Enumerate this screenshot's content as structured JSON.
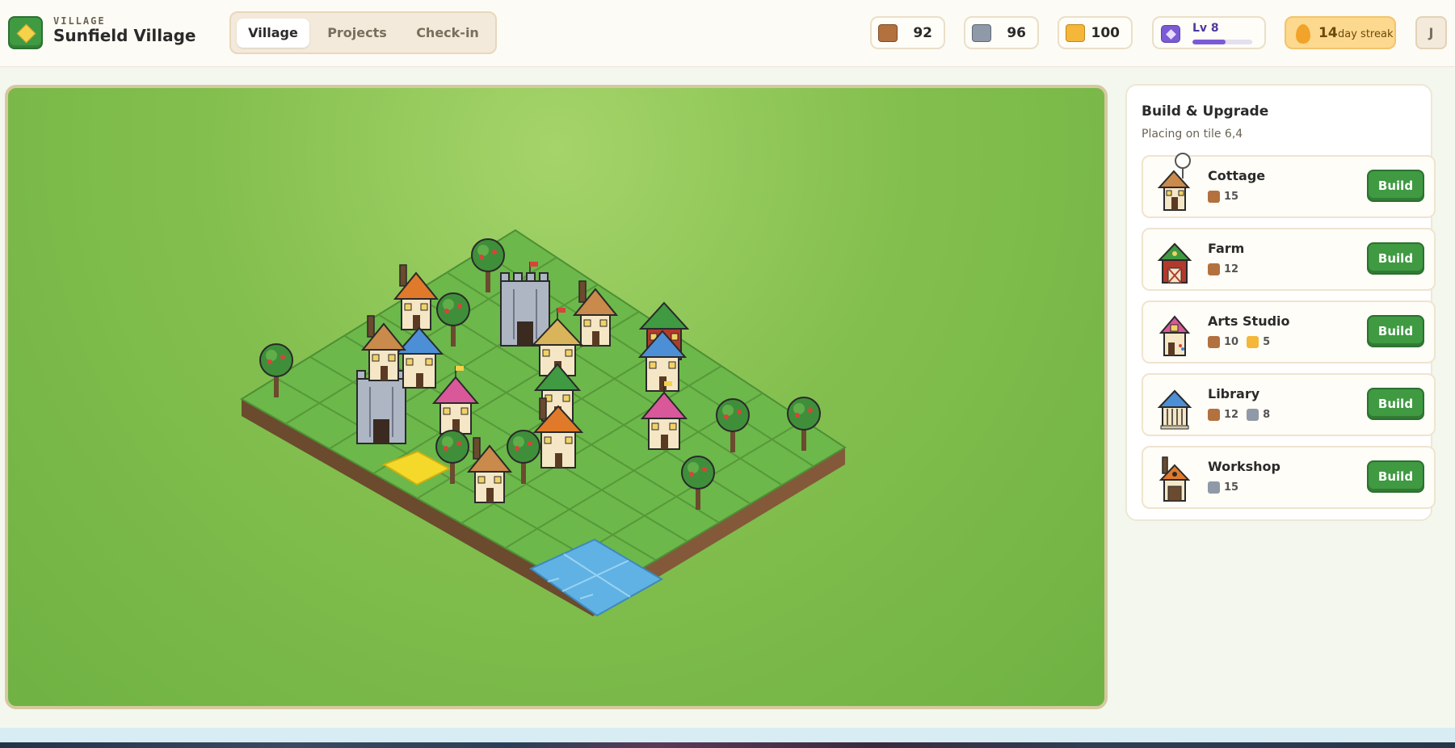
{
  "header": {
    "brand_sub": "VILLAGE",
    "brand_title": "Sunfield Village",
    "tabs": [
      {
        "label": "Village",
        "active": true
      },
      {
        "label": "Projects",
        "active": false
      },
      {
        "label": "Check-in",
        "active": false
      }
    ],
    "resources": [
      {
        "name": "wood",
        "icon": "wood-icon",
        "color": "#b3713f",
        "value": "92"
      },
      {
        "name": "stone",
        "icon": "stone-icon",
        "color": "#8f99a8",
        "value": "96"
      },
      {
        "name": "gold",
        "icon": "gold-icon",
        "color": "#f4b73a",
        "value": "100"
      }
    ],
    "level": {
      "label": "Lv 8",
      "progress": 0.55
    },
    "streak": {
      "number": "14",
      "label": "day streak"
    },
    "avatar_initial": "J"
  },
  "panel": {
    "title": "Build & Upgrade",
    "subtitle": "Placing on tile 6,4",
    "build_label": "Build",
    "items": [
      {
        "name": "Cottage",
        "costs": [
          {
            "res": "wood",
            "color": "#b3713f",
            "amount": "15"
          }
        ]
      },
      {
        "name": "Farm",
        "costs": [
          {
            "res": "wood",
            "color": "#b3713f",
            "amount": "12"
          }
        ]
      },
      {
        "name": "Arts Studio",
        "costs": [
          {
            "res": "wood",
            "color": "#b3713f",
            "amount": "10"
          },
          {
            "res": "gold",
            "color": "#f4b73a",
            "amount": "5"
          }
        ]
      },
      {
        "name": "Library",
        "costs": [
          {
            "res": "wood",
            "color": "#b3713f",
            "amount": "12"
          },
          {
            "res": "stone",
            "color": "#8f99a8",
            "amount": "8"
          }
        ]
      },
      {
        "name": "Workshop",
        "costs": [
          {
            "res": "stone",
            "color": "#8f99a8",
            "amount": "15"
          }
        ]
      }
    ]
  },
  "colors": {
    "accent": "#3f9a42",
    "grass": "#83bf4e",
    "tile": "#6cb84a",
    "selected_tile": "#f4d92b",
    "water": "#5fb2e3"
  }
}
